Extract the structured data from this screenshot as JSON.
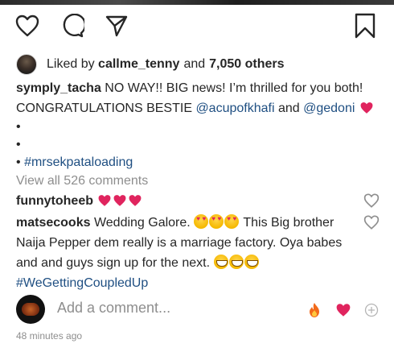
{
  "post": {
    "actions": {
      "like_icon": "heart-outline-icon",
      "comment_icon": "comment-bubble-icon",
      "share_icon": "paper-plane-icon",
      "save_icon": "bookmark-icon"
    },
    "likes": {
      "prefix": "Liked by",
      "user": "callme_tenny",
      "conjunction": "and",
      "count_text": "7,050 others"
    },
    "caption": {
      "username": "symply_tacha",
      "text_line1": "NO WAY!! BIG news! I’m thrilled for you both!",
      "text_line2_start": "CONGRATULATIONS BESTIE ",
      "mention1": "@acupofkhafi",
      "and_text": " and ",
      "mention2": "@gedoni",
      "bullet1": "•",
      "bullet2": "•",
      "bullet3": "•",
      "hashtag": "#mrsekpataloading"
    },
    "view_all_comments": "View all 526 comments",
    "comments": [
      {
        "username": "funnytoheeb",
        "text": ""
      },
      {
        "username": "matsecooks",
        "text_part1": "Wedding Galore.",
        "text_part2": "This Big brother",
        "text_line2": "Naija Pepper dem really is a marriage factory. Oya babes",
        "text_line3": "and and guys sign up for the next.",
        "hashtag": "#WeGettingCoupledUp"
      }
    ],
    "add_comment": {
      "placeholder": "Add a comment...",
      "quick_reactions": [
        "fire-icon",
        "heart-icon",
        "plus-circle-icon"
      ]
    },
    "timestamp": "48 minutes ago"
  },
  "colors": {
    "text": "#262626",
    "muted": "#8e8e8e",
    "link": "#1f4f82",
    "heart_red": "#e0245e"
  }
}
